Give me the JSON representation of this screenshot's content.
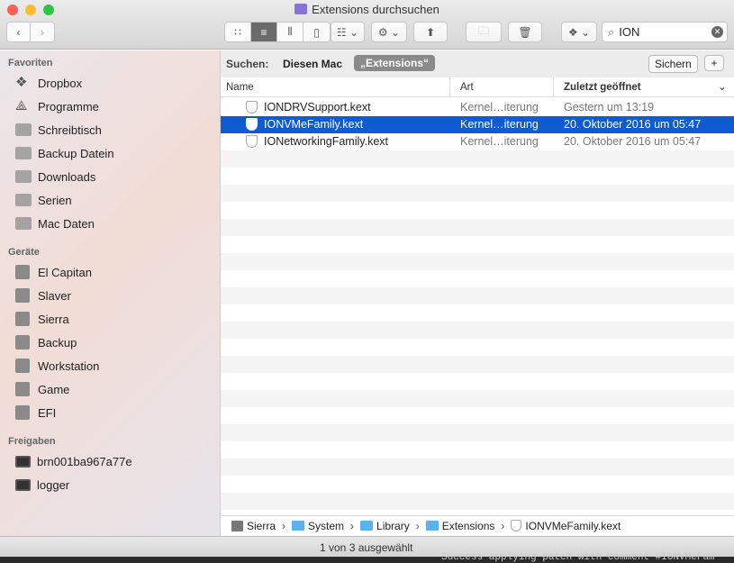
{
  "window": {
    "title": "Extensions durchsuchen"
  },
  "toolbar": {
    "search_value": "ION"
  },
  "sidebar": {
    "favorites_header": "Favoriten",
    "favorites": [
      "Dropbox",
      "Programme",
      "Schreibtisch",
      "Backup Datein",
      "Downloads",
      "Serien",
      "Mac Daten"
    ],
    "devices_header": "Geräte",
    "devices": [
      "El Capitan",
      "Slaver",
      "Sierra",
      "Backup",
      "Workstation",
      "Game",
      "EFI"
    ],
    "shared_header": "Freigaben",
    "shared": [
      "brn001ba967a77e",
      "logger"
    ]
  },
  "scope": {
    "label": "Suchen:",
    "this_mac": "Diesen Mac",
    "folder": "„Extensions“",
    "save": "Sichern",
    "add": "+"
  },
  "columns": {
    "name": "Name",
    "kind": "Art",
    "last_opened": "Zuletzt geöffnet"
  },
  "files": [
    {
      "name": "IONDRVSupport.kext",
      "kind": "Kernel…iterung",
      "date": "Gestern um 13:19"
    },
    {
      "name": "IONVMeFamily.kext",
      "kind": "Kernel…iterung",
      "date": "20. Oktober 2016 um 05:47"
    },
    {
      "name": "IONetworkingFamily.kext",
      "kind": "Kernel…iterung",
      "date": "20. Oktober 2016 um 05:47"
    }
  ],
  "path": [
    "Sierra",
    "System",
    "Library",
    "Extensions",
    "IONVMeFamily.kext"
  ],
  "status": "1 von 3 ausgewählt",
  "background_terminal": "Success applying patch with comment #IONVMeFam"
}
